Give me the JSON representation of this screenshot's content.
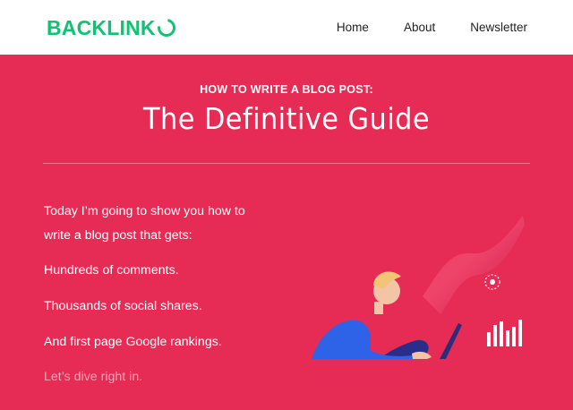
{
  "header": {
    "logo_text": "BACKLINK",
    "logo_brand_color": "#12c274",
    "nav": [
      {
        "label": "Home"
      },
      {
        "label": "About"
      },
      {
        "label": "Newsletter"
      }
    ]
  },
  "hero": {
    "background_color": "#e62b55",
    "eyebrow": "HOW TO WRITE A BLOG POST:",
    "title": "The Definitive Guide",
    "intro_line1": "Today I’m going to show you how to",
    "intro_line2": "write a blog post that gets:",
    "point1": "Hundreds of comments.",
    "point2": "Thousands of social shares.",
    "point3": "And first page Google rankings.",
    "cta": "Let’s dive right in."
  },
  "illustration": {
    "subject": "person-with-laptop-illustration",
    "chart_icon": "bar-chart-icon",
    "target_icon": "target-icon"
  }
}
